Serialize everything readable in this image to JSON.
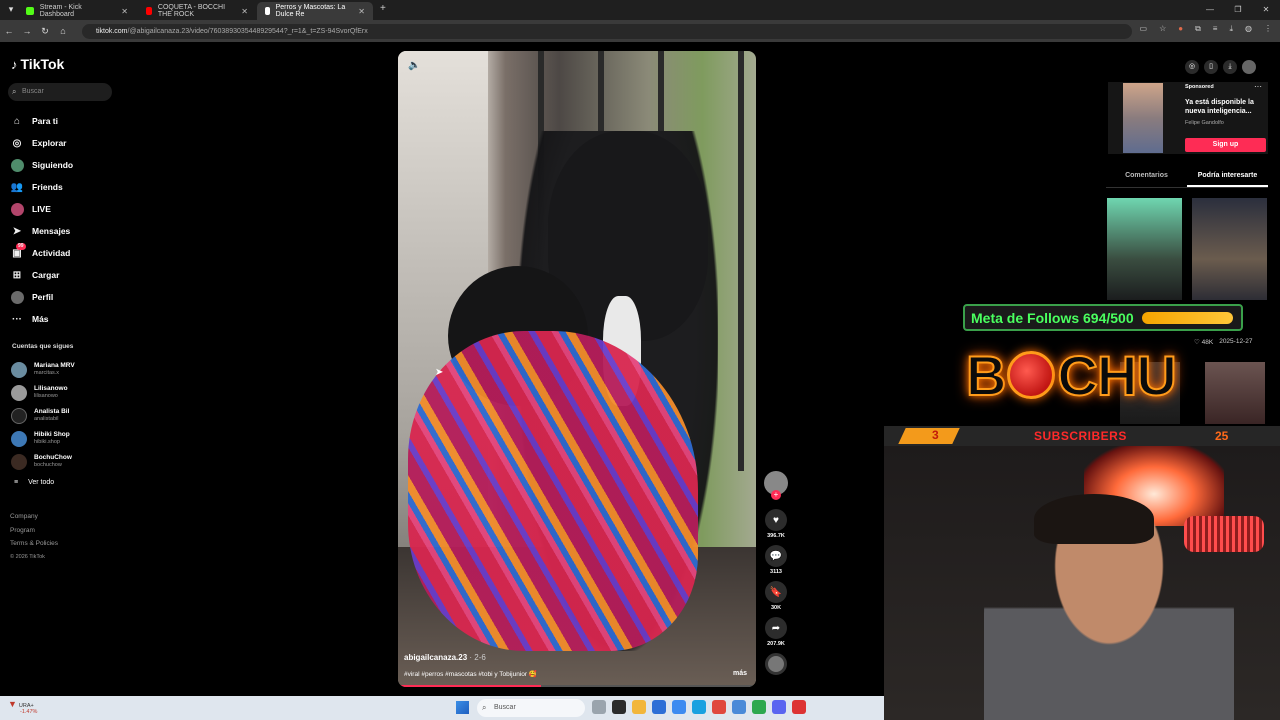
{
  "browser": {
    "tabs": [
      {
        "title": "Stream - Kick Dashboard",
        "active": false,
        "favicon_color": "#53fc18"
      },
      {
        "title": "COQUETA - BOCCHI THE ROCK",
        "active": false,
        "favicon_color": "#ff0000"
      },
      {
        "title": "Perros y Mascotas: La Dulce Re",
        "active": true,
        "favicon_color": "#ffffff"
      }
    ],
    "url_host": "tiktok.com",
    "url_path": "/@abigailcanaza.23/video/7603893035448929544?_r=1&_t=ZS-94SvorQfErx"
  },
  "tiktok": {
    "logo_text": "TikTok",
    "search_placeholder": "Buscar",
    "nav": [
      {
        "label": "Para ti",
        "icon": "home-icon"
      },
      {
        "label": "Explorar",
        "icon": "compass-icon"
      },
      {
        "label": "Siguiendo",
        "icon": "avatar"
      },
      {
        "label": "Friends",
        "icon": "friends-icon"
      },
      {
        "label": "LIVE",
        "icon": "avatar"
      },
      {
        "label": "Mensajes",
        "icon": "send-icon"
      },
      {
        "label": "Actividad",
        "icon": "activity-icon",
        "badge": "99"
      },
      {
        "label": "Cargar",
        "icon": "plus-square-icon"
      },
      {
        "label": "Perfil",
        "icon": "avatar"
      },
      {
        "label": "Más",
        "icon": "more-icon"
      }
    ],
    "following_title": "Cuentas que sigues",
    "following": [
      {
        "name": "Mariana MRV",
        "handle": "marcitas.x"
      },
      {
        "name": "Lilisanowo",
        "handle": "lilisanowo"
      },
      {
        "name": "Analista Bil",
        "handle": "analistabil"
      },
      {
        "name": "Hibiki Shop",
        "handle": "hibiki.shop"
      },
      {
        "name": "BochuChow",
        "handle": "bochuchow"
      }
    ],
    "see_all": "Ver todo",
    "footer": [
      "Company",
      "Program",
      "Terms & Policies"
    ],
    "copyright": "© 2026 TikTok",
    "video": {
      "username": "abigailcanaza.23",
      "date": "· 2-6",
      "description": "#viral #perros #mascotas #tobi y Tobijunior 🥰",
      "more": "más"
    },
    "actions": {
      "likes": "396.7K",
      "comments": "3113",
      "saves": "30K",
      "shares": "207.9K"
    },
    "ad": {
      "sponsored": "Sponsored",
      "title": "Ya está disponible la nueva inteligencia...",
      "advertiser": "Felipe Gandolfo",
      "cta": "Sign up"
    },
    "right_tabs": [
      "Comentarios",
      "Podría interesarte"
    ],
    "stat_likes": "♡ 48K",
    "stat_date": "2025-12-27"
  },
  "stream_overlay": {
    "goal_text": "Meta de Follows 694/500",
    "brand_left": "B",
    "brand_right": "CHU",
    "sub_count_left": "3",
    "sub_label": "SUBSCRIBERS",
    "sub_count_right": "25"
  },
  "taskbar": {
    "weather_label": "URA+",
    "weather_change": "-1.47%",
    "search_placeholder": "Buscar"
  }
}
